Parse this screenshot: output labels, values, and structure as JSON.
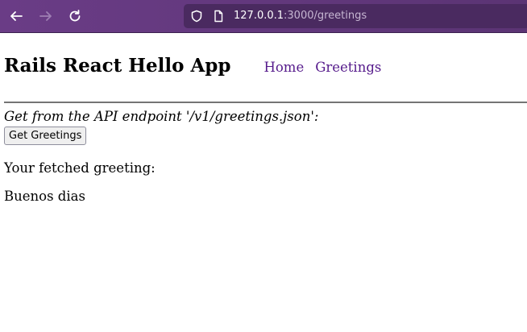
{
  "browser": {
    "url_host": "127.0.0.1",
    "url_path": ":3000/greetings",
    "icons": {
      "back": "back-arrow-icon",
      "forward": "forward-arrow-icon",
      "reload": "reload-icon",
      "shield": "shield-icon",
      "page": "page-icon"
    },
    "colors": {
      "toolbar": "#5b3474",
      "url_box": "#4a2a60"
    }
  },
  "header": {
    "title": "Rails React Hello App",
    "nav": [
      {
        "label": "Home"
      },
      {
        "label": "Greetings"
      }
    ],
    "link_color": "#551a8b"
  },
  "main": {
    "api_label": "Get from the API endpoint '/v1/greetings.json':",
    "button_label": "Get Greetings",
    "fetched_label": "Your fetched greeting:",
    "greeting": "Buenos dias"
  }
}
